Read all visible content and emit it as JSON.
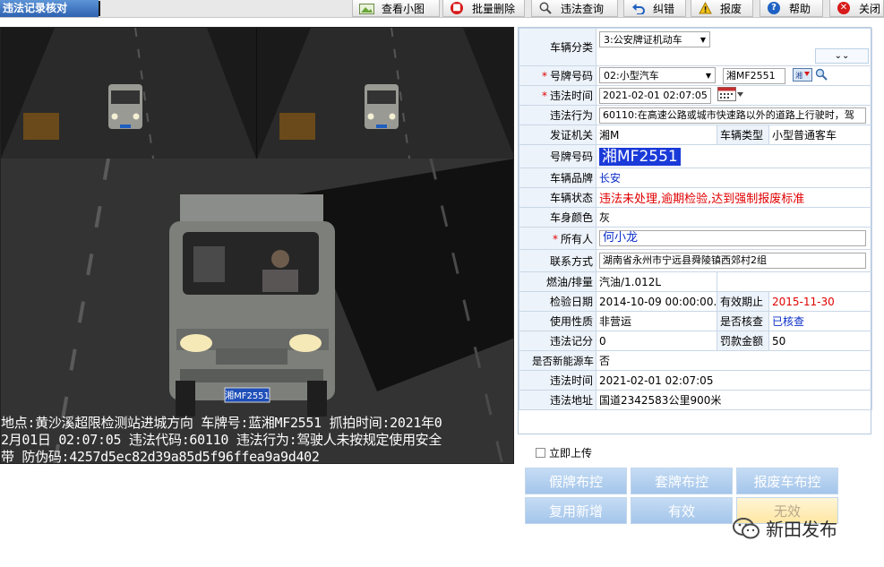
{
  "window": {
    "title": "违法记录核对"
  },
  "toolbar": {
    "view_thumb": "查看小图",
    "batch_delete": "批量删除",
    "violation_query": "违法查询",
    "correct": "纠错",
    "report_error": "报废",
    "help": "帮助",
    "close": "关闭"
  },
  "photo": {
    "plate_on_car": "湘MF2551",
    "ocr_lines": [
      "地点:黄沙溪超限检测站进城方向 车牌号:蓝湘MF2551 抓拍时间:2021年0",
      "2月01日 02:07:05 违法代码:60110 违法行为:驾驶人未按规定使用安全",
      "带 防伪码:4257d5ec82d39a85d5f96ffea9a9d402"
    ]
  },
  "form": {
    "vehicle_category": {
      "label": "车辆分类",
      "value": "3:公安牌证机动车"
    },
    "plate_type": {
      "label": "号牌号码",
      "value": "02:小型汽车",
      "plate_input": "湘MF2551"
    },
    "violation_time": {
      "label": "违法时间",
      "value": "2021-02-01 02:07:05"
    },
    "violation_act": {
      "label": "违法行为",
      "value": "60110:在高速公路或城市快速路以外的道路上行驶时，驾"
    },
    "issuing_authority": {
      "label": "发证机关",
      "value": "湘M"
    },
    "vehicle_type": {
      "label": "车辆类型",
      "value": "小型普通客车"
    },
    "plate_number": {
      "label": "号牌号码",
      "value": "湘MF2551"
    },
    "vehicle_brand": {
      "label": "车辆品牌",
      "value": "长安"
    },
    "vehicle_status": {
      "label": "车辆状态",
      "value": "违法未处理,逾期检验,达到强制报废标准"
    },
    "body_color": {
      "label": "车身颜色",
      "value": "灰"
    },
    "owner": {
      "label": "所有人",
      "value": "何小龙"
    },
    "contact": {
      "label": "联系方式",
      "value": "湖南省永州市宁远县舜陵镇西郊村2组"
    },
    "fuel": {
      "label": "燃油/排量",
      "value": "汽油/1.012L"
    },
    "inspection_date": {
      "label": "检验日期",
      "value": "2014-10-09 00:00:00.0"
    },
    "valid_until": {
      "label": "有效期止",
      "value": "2015-11-30"
    },
    "usage": {
      "label": "使用性质",
      "value": "非营运"
    },
    "checked": {
      "label": "是否核查",
      "value": "已核查"
    },
    "points": {
      "label": "违法记分",
      "value": "0"
    },
    "fine": {
      "label": "罚款金额",
      "value": "50"
    },
    "new_energy": {
      "label": "是否新能源车",
      "value": "否"
    },
    "violation_time2": {
      "label": "违法时间",
      "value": "2021-02-01 02:07:05"
    },
    "location": {
      "label": "违法地址",
      "value": "国道2342583公里900米"
    }
  },
  "actions": {
    "upload_now": "立即上传",
    "fake_plate": "假牌布控",
    "cloned_plate": "套牌布控",
    "scrap_vehicle": "报废车布控",
    "reuse_new": "复用新增",
    "valid": "有效",
    "invalid": "无效"
  },
  "watermark": {
    "text": "新田发布"
  },
  "colors": {
    "title_blue": "#2e62b2",
    "required_red": "#e00000",
    "link_blue": "#0a2ec8",
    "button_blue": "#a4c5ea",
    "plate_highlight": "#1a3ad9"
  }
}
